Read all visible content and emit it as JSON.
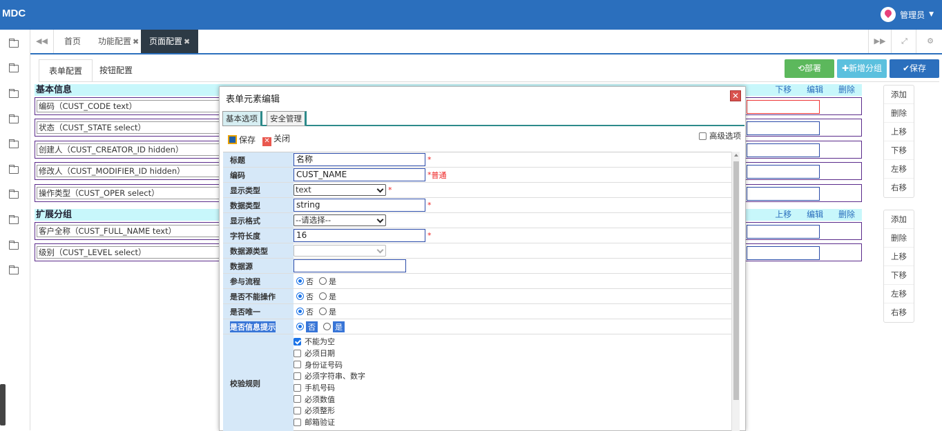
{
  "app": {
    "brand": "MDC",
    "user": "管理员"
  },
  "tabs": [
    {
      "label": "首页"
    },
    {
      "label": "功能配置"
    },
    {
      "label": "页面配置"
    }
  ],
  "subtabs": {
    "form": "表单配置",
    "buttons": "按钮配置"
  },
  "actions": {
    "deploy": "部署",
    "add_group": "新增分组",
    "save": "保存"
  },
  "sections": [
    {
      "title": "基本信息",
      "acts": [
        "下移",
        "编辑",
        "删除"
      ],
      "fields": [
        "编码（CUST_CODE  text）",
        "状态（CUST_STATE  select）",
        "创建人（CUST_CREATOR_ID  hidden）",
        "修改人（CUST_MODIFIER_ID  hidden）",
        "操作类型（CUST_OPER  select）"
      ]
    },
    {
      "title": "扩展分组",
      "acts": [
        "上移",
        "编辑",
        "删除"
      ],
      "fields": [
        "客户全称（CUST_FULL_NAME  text）",
        "级别（CUST_LEVEL  select）"
      ]
    }
  ],
  "side_buttons": [
    "添加",
    "删除",
    "上移",
    "下移",
    "左移",
    "右移"
  ],
  "dialog": {
    "title": "表单元素编辑",
    "close": "✕",
    "tabs": [
      "基本选项",
      "安全管理"
    ],
    "toolbar": {
      "save": "保存",
      "close": "关闭"
    },
    "advanced": "高级选项",
    "rows": {
      "title_label": "标题",
      "title_value": "名称",
      "code_label": "编码",
      "code_value": "CUST_NAME",
      "code_hint": "普通",
      "display_type_label": "显示类型",
      "display_type_value": "text",
      "data_type_label": "数据类型",
      "data_type_value": "string",
      "display_format_label": "显示格式",
      "display_format_value": "--请选择--",
      "length_label": "字符长度",
      "length_value": "16",
      "ds_type_label": "数据源类型",
      "ds_label": "数据源",
      "flow_label": "参与流程",
      "readonly_label": "是否不能操作",
      "unique_label": "是否唯一",
      "tip_label": "是否信息提示",
      "no": "否",
      "yes": "是",
      "req_mark": "*",
      "rules_label": "校验规则"
    },
    "rules": [
      {
        "label": "不能为空",
        "checked": true
      },
      {
        "label": "必须日期",
        "checked": false
      },
      {
        "label": "身份证号码",
        "checked": false
      },
      {
        "label": "必须字符串、数字",
        "checked": false
      },
      {
        "label": "手机号码",
        "checked": false
      },
      {
        "label": "必须数值",
        "checked": false
      },
      {
        "label": "必须整形",
        "checked": false
      },
      {
        "label": "邮箱验证",
        "checked": false
      }
    ]
  },
  "colors": {
    "topbar": "#2b6fbd",
    "deploy": "#5cb85c",
    "add_group": "#5bc0de",
    "save": "#2b6fbd",
    "section": "#c8f7fb"
  }
}
